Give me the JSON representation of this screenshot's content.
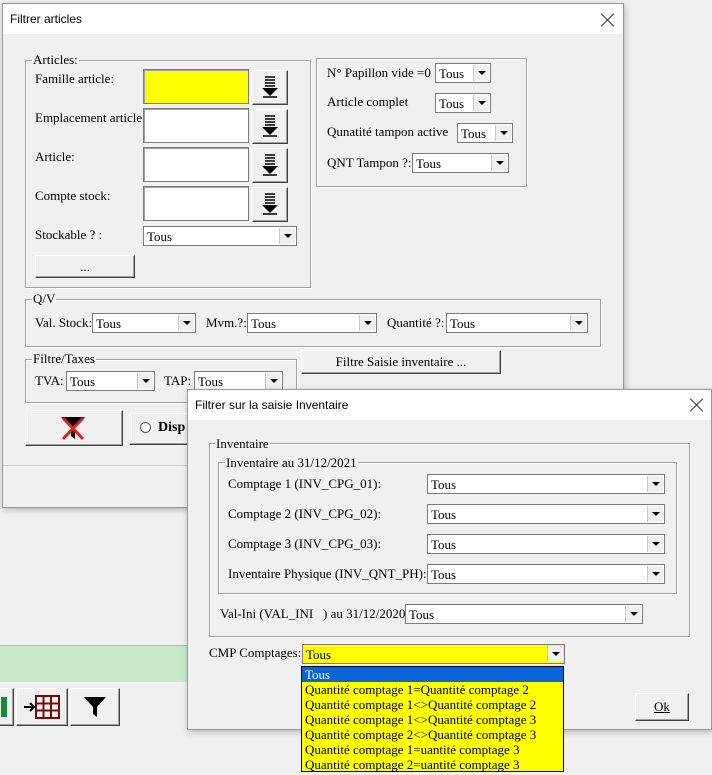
{
  "main_window": {
    "title": "Filtrer articles",
    "articles_group": {
      "legend": "Articles:",
      "famille_label": "Famille article:",
      "emplacement_label": "Emplacement article:",
      "article_label": "Article:",
      "compte_label": "Compte stock:",
      "stockable_label": "Stockable ? :",
      "stockable_value": "Tous",
      "more_button": "..."
    },
    "papillon_group": {
      "papillon_label": "N° Papillon vide =0",
      "papillon_value": "Tous",
      "complet_label": "Article complet",
      "complet_value": "Tous",
      "tampon_active_label": "Qunatité tampon active",
      "tampon_active_value": "Tous",
      "qnt_tampon_label": "QNT Tampon ?:",
      "qnt_tampon_value": "Tous"
    },
    "qv_group": {
      "legend": "Q/V",
      "val_stock_label": "Val. Stock:",
      "val_stock_value": "Tous",
      "mvm_label": "Mvm.?:",
      "mvm_value": "Tous",
      "quantite_label": "Quantité ?:",
      "quantite_value": "Tous"
    },
    "taxes_group": {
      "legend": "Filtre/Taxes",
      "tva_label": "TVA:",
      "tva_value": "Tous",
      "tap_label": "TAP:",
      "tap_value": "Tous"
    },
    "saisie_button": "Filtre Saisie inventaire ...",
    "radio_label": "Disp"
  },
  "dialog": {
    "title": "Filtrer sur la saisie Inventaire",
    "inventaire_legend": "Inventaire",
    "inner_legend": "Inventaire au 31/12/2021",
    "c1_label": "Comptage 1 (INV_CPG_01):",
    "c1_value": "Tous",
    "c2_label": "Comptage 2 (INV_CPG_02):",
    "c2_value": "Tous",
    "c3_label": "Comptage 3 (INV_CPG_03):",
    "c3_value": "Tous",
    "phys_label": "Inventaire Physique (INV_QNT_PH):",
    "phys_value": "Tous",
    "valini_label": "Val-Ini (VAL_INI   ) au 31/12/2020 :",
    "valini_value": "Tous",
    "cmp_label": "CMP Comptages:",
    "cmp_value": "Tous",
    "cmp_options": [
      "Tous",
      "Quantité comptage 1=Quantité comptage 2",
      "Quantité comptage 1<>Quantité comptage 2",
      "Quantité comptage 1<>Quantité comptage 3",
      "Quantité comptage 2<>Quantité comptage 3",
      "Quantité comptage 1=uantité comptage 3",
      "Quantité comptage 2=uantité comptage 3"
    ],
    "ok_button": "Ok"
  },
  "colors": {
    "highlight": "#0a64d8",
    "yellow": "#ffff00",
    "filter_x": "#e02020"
  }
}
